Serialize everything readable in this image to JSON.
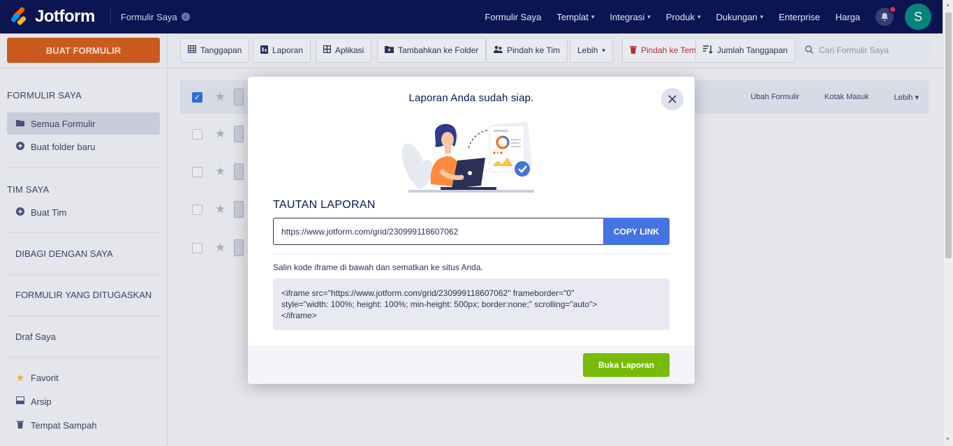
{
  "topbar": {
    "logo_text": "Jotform",
    "form_title": "Formulir Saya",
    "nav": [
      {
        "label": "Formulir Saya",
        "caret": false
      },
      {
        "label": "Templat",
        "caret": true
      },
      {
        "label": "Integrasi",
        "caret": true
      },
      {
        "label": "Produk",
        "caret": true
      },
      {
        "label": "Dukungan",
        "caret": true
      },
      {
        "label": "Enterprise",
        "caret": false
      },
      {
        "label": "Harga",
        "caret": false
      }
    ],
    "avatar_letter": "S"
  },
  "sidebar": {
    "create_label": "BUAT FORMULIR",
    "my_forms_heading": "FORMULIR SAYA",
    "all_forms": "Semua Formulir",
    "new_folder": "Buat folder baru",
    "my_team_heading": "TIM SAYA",
    "create_team": "Buat Tim",
    "shared_with_me": "DIBAGI DENGAN SAYA",
    "assigned_forms": "FORMULIR YANG DITUGASKAN",
    "drafts": "Draf Saya",
    "favorites": "Favorit",
    "archive": "Arsip",
    "trash": "Tempat Sampah"
  },
  "toolbar": {
    "responses": "Tanggapan",
    "reports": "Laporan",
    "apps": "Aplikasi",
    "add_to_folder": "Tambahkan ke Folder",
    "move_to_team": "Pindah ke Tim",
    "more": "Lebih",
    "move_to_trash": "Pindah ke Tem",
    "response_count": "Jumlah Tanggapan",
    "search_placeholder": "Cari Formulir Saya"
  },
  "list": {
    "edit_form": "Ubah Formulir",
    "inbox": "Kotak Masuk",
    "more": "Lebih"
  },
  "modal": {
    "title": "Laporan Anda sudah siap.",
    "link_section_label": "TAUTAN LAPORAN",
    "report_url": "https://www.jotform.com/grid/230999118607062",
    "copy_link_label": "COPY LINK",
    "embed_instruction": "Salin kode iframe di bawah dan sematkan ke situs Anda.",
    "embed_code_line1": "<iframe src=\"https://www.jotform.com/grid/230999118607062\" frameborder=\"0\"",
    "embed_code_line2": "style=\"width: 100%; height: 100%; min-height: 500px; border:none;\" scrolling=\"auto\">",
    "embed_code_line3": "</iframe>",
    "open_report_label": "Buka Laporan"
  },
  "colors": {
    "navy": "#0a1551",
    "create_orange": "#cc5a1e",
    "copy_blue": "#4573e2",
    "open_green": "#78bb07",
    "avatar_teal": "#09837e"
  }
}
